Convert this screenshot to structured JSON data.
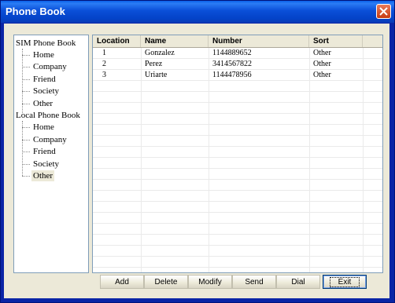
{
  "window": {
    "title": "Phone Book"
  },
  "tree": {
    "roots": [
      {
        "label": "SIM Phone Book",
        "children": [
          "Home",
          "Company",
          "Friend",
          "Society",
          "Other"
        ]
      },
      {
        "label": "Local Phone Book",
        "children": [
          "Home",
          "Company",
          "Friend",
          "Society",
          "Other"
        ]
      }
    ],
    "selected": "Local Phone Book / Other"
  },
  "table": {
    "columns": [
      "Location",
      "Name",
      "Number",
      "Sort"
    ],
    "rows": [
      [
        "1",
        "Gonzalez",
        "1144889652",
        "Other"
      ],
      [
        "2",
        "Perez",
        "3414567822",
        "Other"
      ],
      [
        "3",
        "Uriarte",
        "1144478956",
        "Other"
      ]
    ]
  },
  "buttons": {
    "add": "Add",
    "delete": "Delete",
    "modify": "Modify",
    "send": "Send",
    "dial": "Dial",
    "exit": "Exit"
  },
  "icons": {
    "close": "close-icon"
  },
  "colors": {
    "titlebar": "#0a4fd8",
    "close": "#c63b12",
    "client": "#ece9d8"
  }
}
